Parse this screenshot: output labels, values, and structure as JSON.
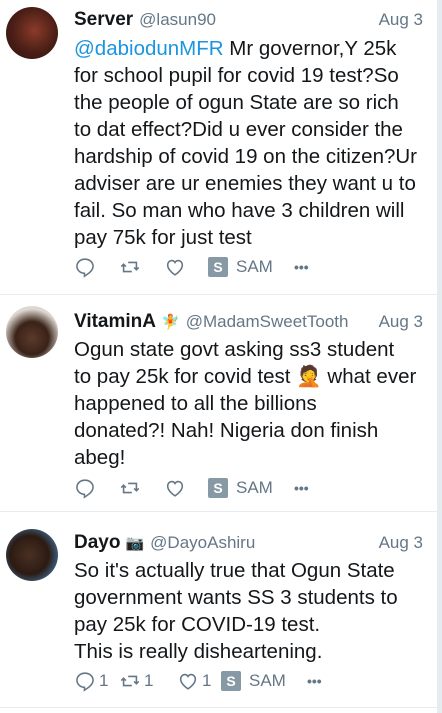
{
  "tweets": [
    {
      "name": "Server",
      "handle": "@lasun90",
      "date": "Aug 3",
      "badge": "",
      "mention": "@dabiodunMFR",
      "lines": [
        " Mr governor,Y 25k",
        "for school pupil for covid 19 test?So",
        "the people of ogun State are so rich",
        "to dat effect?Did u ever consider the",
        "hardship of covid 19 on the citizen?Ur",
        "adviser are ur enemies they want u to",
        "fail. So man who have 3 children will",
        "pay 75k for just test"
      ],
      "reply_count": "",
      "retweet_count": "",
      "like_count": "",
      "sam_label": "SAM",
      "s_label": "S",
      "more_label": "•••"
    },
    {
      "name": "VitaminA",
      "handle": "@MadamSweetTooth",
      "date": "Aug 3",
      "badge": "🧚",
      "lines": [
        "Ogun state govt asking ss3 student",
        "to pay 25k for covid test 🤦 what ever",
        "happened to all the billions",
        "donated?! Nah! Nigeria don finish",
        "abeg!"
      ],
      "reply_count": "",
      "retweet_count": "",
      "like_count": "",
      "sam_label": "SAM",
      "s_label": "S",
      "more_label": "•••"
    },
    {
      "name": "Dayo",
      "handle": "@DayoAshiru",
      "date": "Aug 3",
      "badge": "📷",
      "lines": [
        "So it's actually true that Ogun State",
        "government wants SS 3 students to",
        "pay 25k for COVID-19 test.",
        "This is really disheartening."
      ],
      "reply_count": "1",
      "retweet_count": "1",
      "like_count": "1",
      "sam_label": "SAM",
      "s_label": "S",
      "more_label": "•••"
    }
  ]
}
